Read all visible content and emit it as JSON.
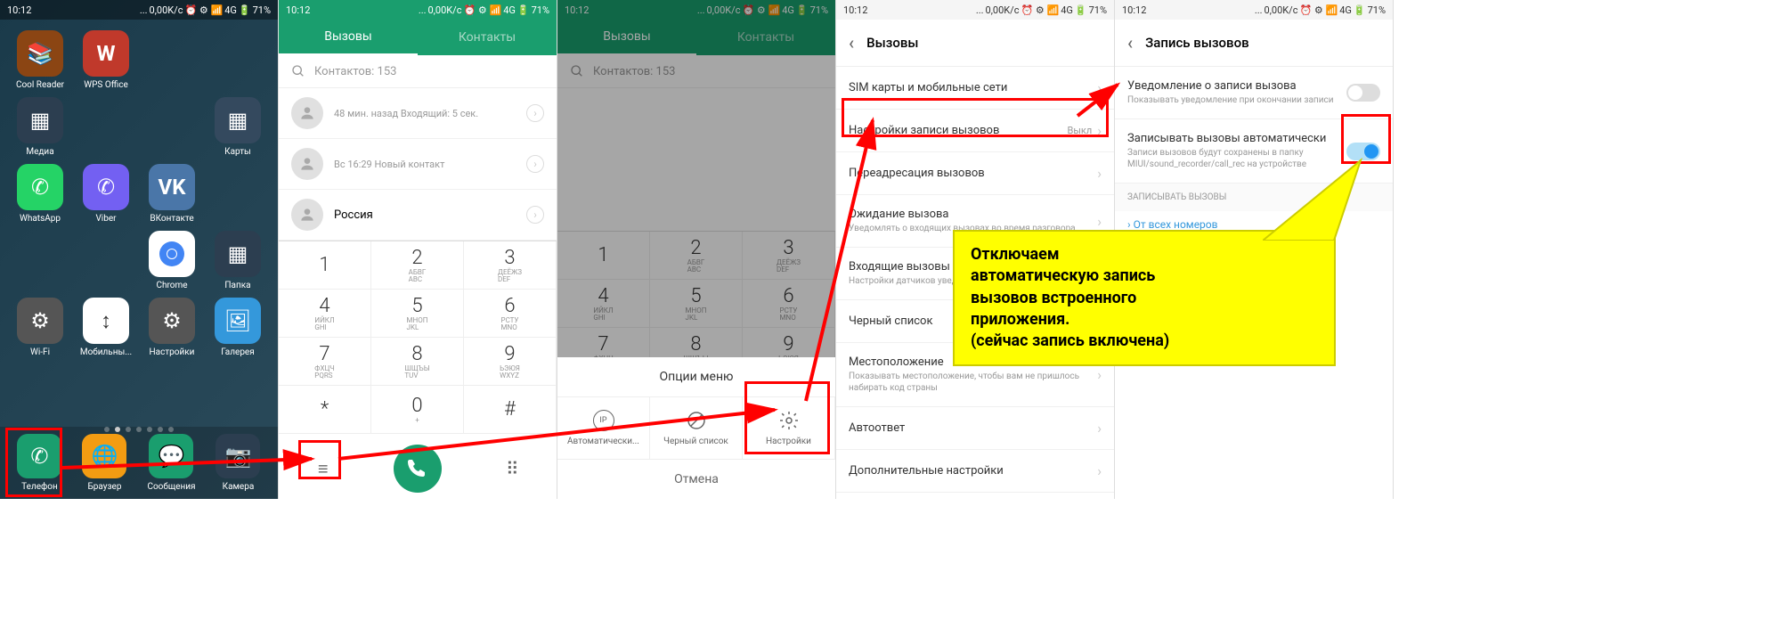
{
  "status": {
    "time": "10:12",
    "speed": "0,00K/c",
    "signal": "4G",
    "battery": "71%"
  },
  "s1": {
    "apps": [
      {
        "label": "Cool Reader",
        "bg": "#8b4513"
      },
      {
        "label": "WPS Office",
        "bg": "#c0392b"
      },
      {
        "label": "Медиа",
        "bg": "#2c3e50"
      },
      {
        "label": "Карты",
        "bg": "#34495e"
      },
      {
        "label": "WhatsApp",
        "bg": "#25d366"
      },
      {
        "label": "Viber",
        "bg": "#7360f2"
      },
      {
        "label": "ВКонтакте",
        "bg": "#4a76a8"
      },
      {
        "label": "Chrome",
        "bg": "#fff"
      },
      {
        "label": "Папка",
        "bg": "#2c3e50"
      },
      {
        "label": "Wi-Fi",
        "bg": "#555"
      },
      {
        "label": "Мобильны...",
        "bg": "#fff"
      },
      {
        "label": "Настройки",
        "bg": "#555"
      },
      {
        "label": "Галерея",
        "bg": "#3498db"
      }
    ],
    "dock": [
      {
        "label": "Телефон",
        "bg": "#1a9e6e"
      },
      {
        "label": "Браузер",
        "bg": "#f39c12"
      },
      {
        "label": "Сообщения",
        "bg": "#1a9e6e"
      },
      {
        "label": "Камера",
        "bg": "#2c3e50"
      }
    ]
  },
  "s2": {
    "tabs": {
      "calls": "Вызовы",
      "contacts": "Контакты"
    },
    "search": "Контактов: 153",
    "calls": [
      {
        "sub": "48 мин. назад Входящий: 5 сек."
      },
      {
        "sub": "Вс 16:29 Новый контакт"
      },
      {
        "name": "Россия"
      }
    ],
    "keys": [
      {
        "n": "1",
        "l": ""
      },
      {
        "n": "2",
        "l": "АБВГ",
        "l2": "ABC"
      },
      {
        "n": "3",
        "l": "ДЕЁЖЗ",
        "l2": "DEF"
      },
      {
        "n": "4",
        "l": "ИЙКЛ",
        "l2": "GHI"
      },
      {
        "n": "5",
        "l": "МНОП",
        "l2": "JKL"
      },
      {
        "n": "6",
        "l": "РСТУ",
        "l2": "MNO"
      },
      {
        "n": "7",
        "l": "ФХЦЧ",
        "l2": "PQRS"
      },
      {
        "n": "8",
        "l": "ШЩЪЫ",
        "l2": "TUV"
      },
      {
        "n": "9",
        "l": "ЬЭЮЯ",
        "l2": "WXYZ"
      },
      {
        "n": "*",
        "l": ""
      },
      {
        "n": "0",
        "l": "+"
      },
      {
        "n": "#",
        "l": ""
      }
    ]
  },
  "s3": {
    "menu_title": "Опции меню",
    "opts": [
      {
        "label": "Автоматически...",
        "icon": "ip"
      },
      {
        "label": "Черный список",
        "icon": "block"
      },
      {
        "label": "Настройки",
        "icon": "gear"
      }
    ],
    "cancel": "Отмена"
  },
  "s4": {
    "title": "Вызовы",
    "items": [
      {
        "title": "SIM карты и мобильные сети"
      },
      {
        "title": "Настройки записи вызовов",
        "value": "Выкл"
      },
      {
        "title": "Переадресация вызовов"
      },
      {
        "title": "Ожидание вызова",
        "sub": "Уведомлять о входящих вызовах во время разговора"
      },
      {
        "title": "Входящие вызовы",
        "sub": "Настройки датчиков уведомлений при входящем вызове"
      },
      {
        "title": "Черный список"
      },
      {
        "title": "Местоположение",
        "sub": "Показывать местоположение, чтобы вам не пришлось набирать код страны"
      },
      {
        "title": "Автоответ"
      },
      {
        "title": "Дополнительные настройки"
      }
    ]
  },
  "s5": {
    "title": "Запись вызовов",
    "items": [
      {
        "title": "Уведомление о записи вызова",
        "sub": "Показывать уведомление при окончании записи",
        "toggle": false
      },
      {
        "title": "Записывать вызовы автоматически",
        "sub": "Записи вызовов будут сохранены в папку MIUI/sound_recorder/call_rec на устройстве",
        "toggle": true
      }
    ],
    "section": "ЗАПИСЫВАТЬ ВЫЗОВЫ",
    "link": "От всех номеров"
  },
  "callout": {
    "line1": "Отключаем",
    "line2": "автоматическую запись",
    "line3": "вызовов встроенного",
    "line4": "приложения.",
    "line5": "(сейчас запись включена)"
  }
}
